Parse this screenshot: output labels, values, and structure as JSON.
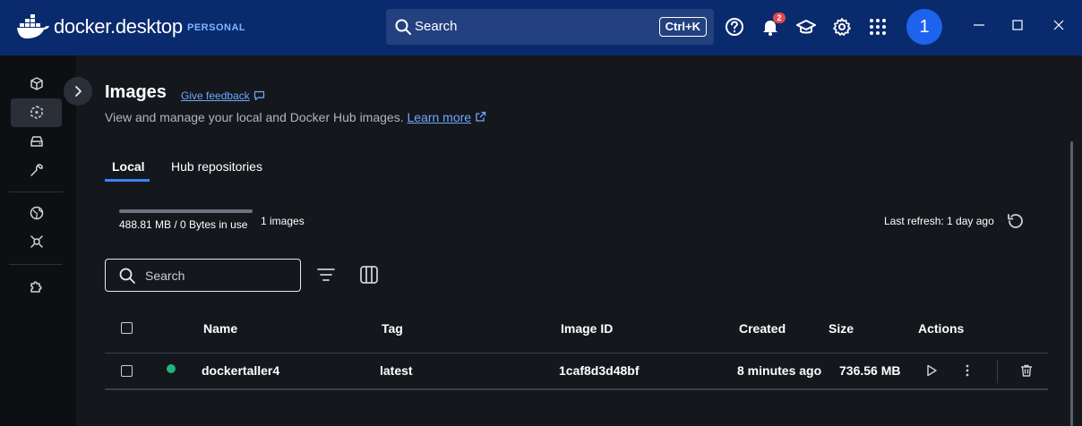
{
  "app": {
    "logo_text_bold": "docker",
    "logo_text_light": "desktop",
    "plan": "PERSONAL",
    "search_label": "Search",
    "search_shortcut": "Ctrl+K",
    "notification_count": "2",
    "avatar_initial": "1"
  },
  "page": {
    "title": "Images",
    "feedback_link": "Give feedback",
    "subtitle": "View and manage your local and Docker Hub images.",
    "learn_more": "Learn more",
    "tabs": [
      {
        "label": "Local",
        "active": true
      },
      {
        "label": "Hub repositories",
        "active": false
      }
    ]
  },
  "summary": {
    "usage_text": "488.81 MB / 0 Bytes in use",
    "image_count": "1 images",
    "last_refresh": "Last refresh: 1 day ago"
  },
  "toolbar": {
    "search_placeholder": "Search"
  },
  "table": {
    "columns": [
      "Name",
      "Tag",
      "Image ID",
      "Created",
      "Size",
      "Actions"
    ],
    "rows": [
      {
        "status": "in-use",
        "name": "dockertaller4",
        "tag": "latest",
        "image_id": "1caf8d3d48bf",
        "created": "8 minutes ago",
        "size": "736.56 MB"
      }
    ]
  },
  "colors": {
    "titlebar": "#0a2a6e",
    "accent": "#3b82f6",
    "status_in_use": "#21b57d",
    "badge": "#e5484d"
  }
}
